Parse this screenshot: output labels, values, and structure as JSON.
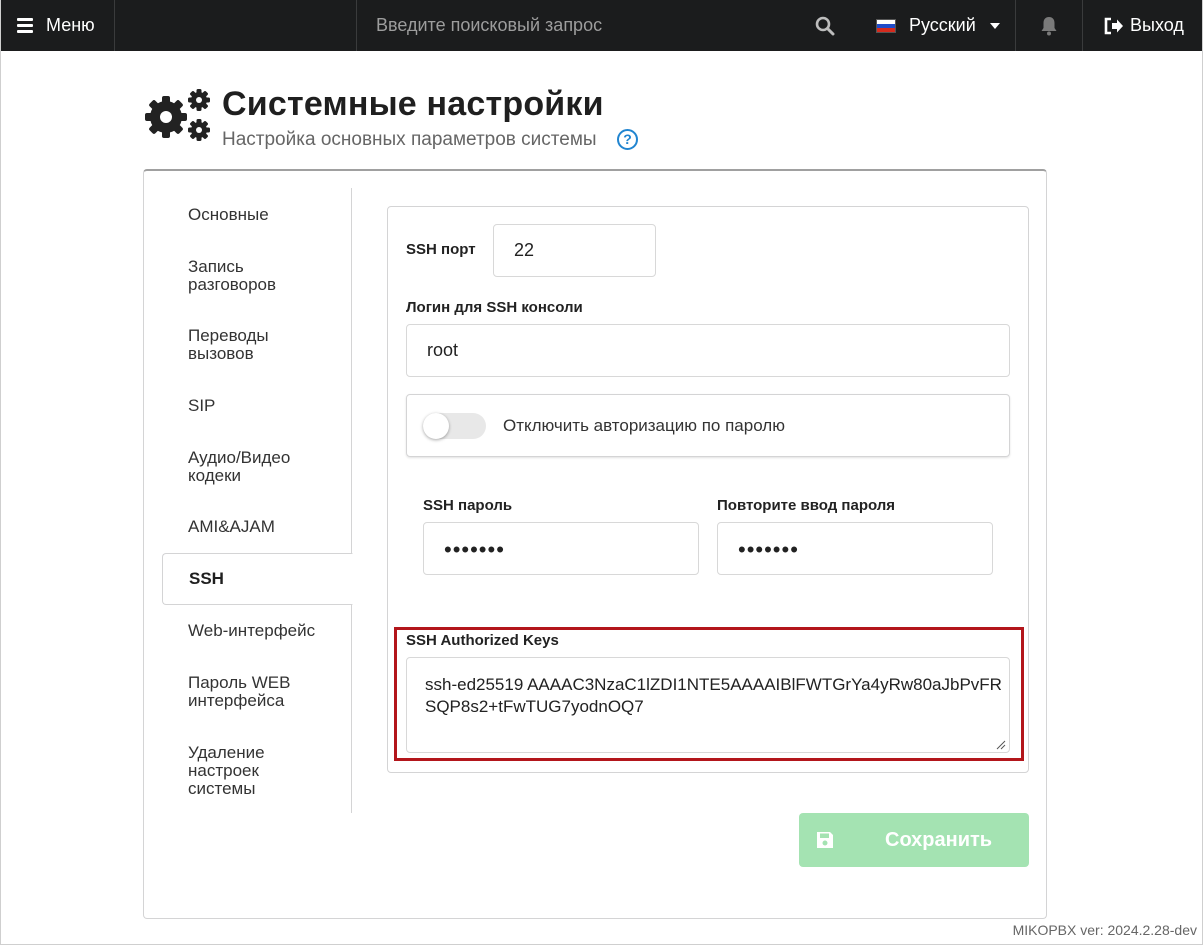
{
  "topbar": {
    "menu_label": "Меню",
    "search_placeholder": "Введите поисковый запрос",
    "language": "Русский",
    "exit_label": "Выход"
  },
  "header": {
    "title": "Системные настройки",
    "subtitle": "Настройка основных параметров системы"
  },
  "tabs": [
    {
      "label": "Основные"
    },
    {
      "label": "Запись разговоров"
    },
    {
      "label": "Переводы вызовов"
    },
    {
      "label": "SIP"
    },
    {
      "label": "Аудио/Видео кодеки"
    },
    {
      "label": "AMI&AJAM"
    },
    {
      "label": "SSH",
      "active": true
    },
    {
      "label": "Web-интерфейс"
    },
    {
      "label": "Пароль WEB интерфейса"
    },
    {
      "label": "Удаление настроек системы"
    }
  ],
  "form": {
    "ssh_port_label": "SSH порт",
    "ssh_port_value": "22",
    "ssh_login_label": "Логин для SSH консоли",
    "ssh_login_value": "root",
    "disable_password_auth_label": "Отключить авторизацию по паролю",
    "disable_password_auth_checked": false,
    "ssh_password_label": "SSH пароль",
    "ssh_password_value": "•••••••",
    "ssh_password_repeat_label": "Повторите ввод пароля",
    "ssh_password_repeat_value": "•••••••",
    "authorized_keys_label": "SSH Authorized Keys",
    "authorized_keys_value": "ssh-ed25519 AAAAC3NzaC1lZDI1NTE5AAAAIBlFWTGrYa4yRw80aJbPvFRSQP8s2+tFwTUG7yodnOQ7"
  },
  "save_button_label": "Сохранить",
  "version": "MIKOPBX ver: 2024.2.28-dev",
  "colors": {
    "topbar": "#1b1c1d",
    "accent_blue": "#2185d0",
    "highlight_red": "#b3161b",
    "save_green_disabled": "#a4e3b2"
  },
  "icons": [
    "hamburger-icon",
    "search-icon",
    "russia-flag-icon",
    "chevron-down-icon",
    "bell-icon",
    "sign-out-icon",
    "cogs-icon",
    "help-circle-icon",
    "save-icon",
    "resize-handle-icon"
  ]
}
